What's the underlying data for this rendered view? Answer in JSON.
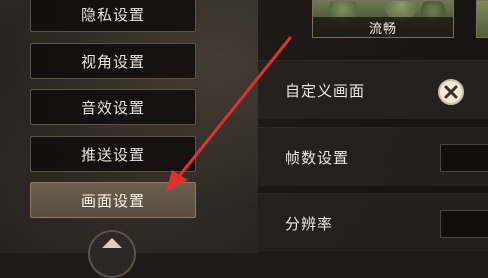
{
  "sidebar": {
    "items": [
      {
        "label": "隐私设置"
      },
      {
        "label": "视角设置"
      },
      {
        "label": "音效设置"
      },
      {
        "label": "推送设置"
      },
      {
        "label": "画面设置",
        "active": true
      }
    ]
  },
  "graphics": {
    "quality_options": [
      {
        "label": "流畅"
      }
    ],
    "rows": [
      {
        "label": "自定义画面",
        "control": "toggle-x"
      },
      {
        "label": "帧数设置",
        "control": "dropdown"
      },
      {
        "label": "分辨率",
        "control": "dropdown"
      }
    ]
  },
  "annotation": {
    "arrow_color": "#e03131",
    "points_to": "画面设置"
  },
  "colors": {
    "active_tab": "#6b604f",
    "panel_bg": "#282420",
    "text": "#ece7df"
  }
}
